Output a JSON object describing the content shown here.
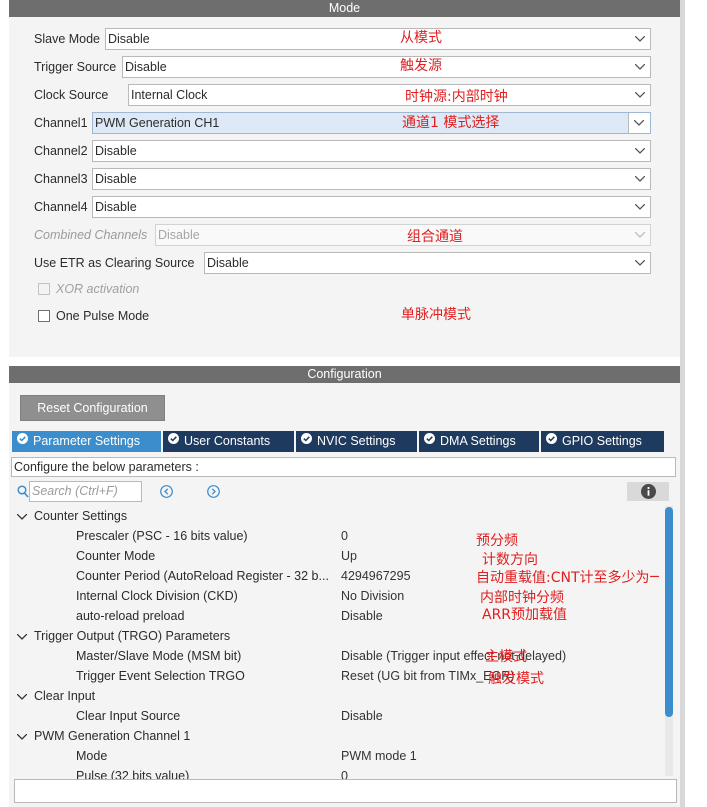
{
  "mode_panel": {
    "header": "Mode",
    "fields": [
      {
        "label": "Slave Mode",
        "value": "Disable",
        "annotation": "从模式"
      },
      {
        "label": "Trigger Source",
        "value": "Disable",
        "annotation": "触发源"
      },
      {
        "label": "Clock Source",
        "value": "Internal Clock",
        "annotation": "时钟源:内部时钟"
      },
      {
        "label": "Channel1",
        "value": "PWM Generation CH1",
        "annotation": "通道1 模式选择"
      },
      {
        "label": "Channel2",
        "value": "Disable"
      },
      {
        "label": "Channel3",
        "value": "Disable"
      },
      {
        "label": "Channel4",
        "value": "Disable"
      },
      {
        "label": "Combined Channels",
        "value": "Disable",
        "annotation": "组合通道"
      },
      {
        "label": "Use ETR as Clearing Source",
        "value": "Disable"
      }
    ],
    "xor_activation": "XOR activation",
    "one_pulse_mode": "One Pulse Mode",
    "one_pulse_annotation": "单脉冲模式"
  },
  "config_panel": {
    "header": "Configuration",
    "reset_button": "Reset Configuration",
    "tabs": [
      {
        "label": "Parameter Settings",
        "active": true
      },
      {
        "label": "User Constants"
      },
      {
        "label": "NVIC Settings"
      },
      {
        "label": "DMA Settings"
      },
      {
        "label": "GPIO Settings"
      }
    ],
    "configure_text": "Configure the below parameters :",
    "search_placeholder": "Search (Ctrl+F)",
    "groups": [
      {
        "title": "Counter Settings",
        "params": [
          {
            "name": "Prescaler (PSC - 16 bits value)",
            "value": "0",
            "annotation": "预分频"
          },
          {
            "name": "Counter Mode",
            "value": "Up",
            "annotation": "计数方向"
          },
          {
            "name": "Counter Period (AutoReload Register - 32 b...",
            "value": "4294967295",
            "annotation": "自动重载值:CNT计至多少为一期"
          },
          {
            "name": "Internal Clock Division (CKD)",
            "value": "No Division",
            "annotation": "内部时钟分频"
          },
          {
            "name": "auto-reload preload",
            "value": "Disable",
            "annotation": "ARR预加载值"
          }
        ]
      },
      {
        "title": "Trigger Output (TRGO) Parameters",
        "params": [
          {
            "name": "Master/Slave Mode (MSM bit)",
            "value": "Disable (Trigger input effect not delayed)",
            "annotation": "主模式"
          },
          {
            "name": "Trigger Event Selection TRGO",
            "value": "Reset (UG bit from TIMx_EGR)",
            "annotation": "触发模式"
          }
        ]
      },
      {
        "title": "Clear Input",
        "params": [
          {
            "name": "Clear Input Source",
            "value": "Disable"
          }
        ]
      },
      {
        "title": "PWM Generation Channel 1",
        "params": [
          {
            "name": "Mode",
            "value": "PWM mode 1"
          },
          {
            "name": "Pulse (32 bits value)",
            "value": "0"
          }
        ]
      }
    ]
  },
  "colors": {
    "header_bg": "#6e6e6e",
    "tab_bg": "#1e3a5f",
    "tab_active_bg": "#3c8dcc",
    "annotation": "#e02020",
    "highlight_select": "#dde9f6"
  }
}
